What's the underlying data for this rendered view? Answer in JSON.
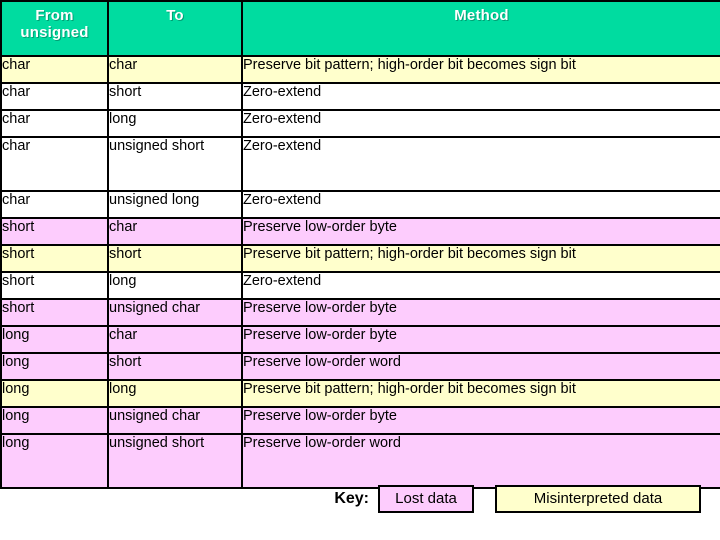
{
  "table": {
    "headers": [
      {
        "label": "From\nunsigned",
        "line1": "From",
        "line2": "unsigned"
      },
      {
        "label": "To"
      },
      {
        "label": "Method"
      }
    ],
    "header_bg": "#00DCA0",
    "header_text_color": "#ffffff",
    "colors": {
      "white": "#ffffff",
      "yellow": "#FFFFCC",
      "pink": "#FDCCFD",
      "border": "#000000"
    },
    "rows": [
      {
        "from": "char",
        "to": "char",
        "method": "Preserve bit pattern; high-order bit becomes sign bit",
        "highlight": "yellow",
        "tall": false
      },
      {
        "from": "char",
        "to": "short",
        "method": "Zero-extend",
        "highlight": "white",
        "tall": false
      },
      {
        "from": "char",
        "to": "long",
        "method": "Zero-extend",
        "highlight": "white",
        "tall": false
      },
      {
        "from": "char",
        "to": "unsigned short",
        "method": "Zero-extend",
        "highlight": "white",
        "tall": true
      },
      {
        "from": "char",
        "to": "unsigned long",
        "method": "Zero-extend",
        "highlight": "white",
        "tall": false
      },
      {
        "from": "short",
        "to": "char",
        "method": "Preserve low-order byte",
        "highlight": "pink",
        "tall": false
      },
      {
        "from": "short",
        "to": "short",
        "method": "Preserve bit pattern; high-order bit becomes sign bit",
        "highlight": "yellow",
        "tall": false
      },
      {
        "from": "short",
        "to": "long",
        "method": "Zero-extend",
        "highlight": "white",
        "tall": false
      },
      {
        "from": "short",
        "to": "unsigned char",
        "method": "Preserve low-order byte",
        "highlight": "pink",
        "tall": false
      },
      {
        "from": "long",
        "to": "char",
        "method": "Preserve low-order byte",
        "highlight": "pink",
        "tall": false
      },
      {
        "from": "long",
        "to": "short",
        "method": "Preserve low-order word",
        "highlight": "pink",
        "tall": false
      },
      {
        "from": "long",
        "to": "long",
        "method": "Preserve bit pattern; high-order bit becomes sign bit",
        "highlight": "yellow",
        "tall": false
      },
      {
        "from": "long",
        "to": "unsigned char",
        "method": "Preserve low-order byte",
        "highlight": "pink",
        "tall": false
      },
      {
        "from": "long",
        "to": "unsigned short",
        "method": "Preserve low-order word",
        "highlight": "pink",
        "tall": true
      }
    ]
  },
  "key": {
    "label": "Key:",
    "items": [
      {
        "text": "Lost data",
        "color": "#FDCCFD"
      },
      {
        "text": "Misinterpreted data",
        "color": "#FFFFCC"
      }
    ]
  }
}
